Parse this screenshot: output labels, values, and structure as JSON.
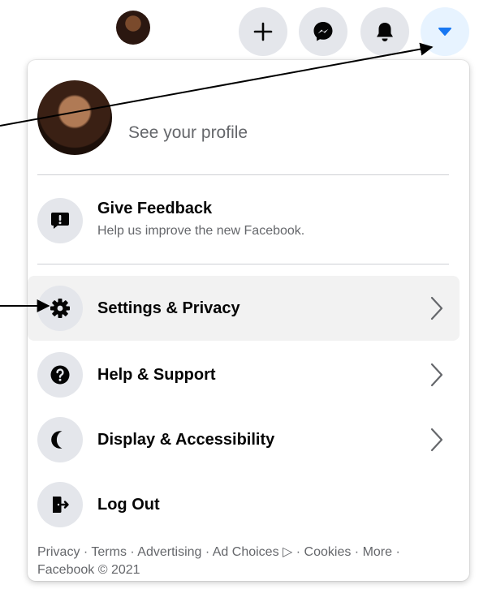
{
  "topbar": {
    "buttons": [
      {
        "icon": "plus-icon"
      },
      {
        "icon": "messenger-icon"
      },
      {
        "icon": "bell-icon"
      },
      {
        "icon": "caret-down-icon"
      }
    ]
  },
  "menu": {
    "profile": {
      "label": "See your profile"
    },
    "feedback": {
      "title": "Give Feedback",
      "subtitle": "Help us improve the new Facebook."
    },
    "items": [
      {
        "label": "Settings & Privacy",
        "icon": "gear-icon",
        "has_submenu": true
      },
      {
        "label": "Help & Support",
        "icon": "question-icon",
        "has_submenu": true
      },
      {
        "label": "Display & Accessibility",
        "icon": "moon-icon",
        "has_submenu": true
      },
      {
        "label": "Log Out",
        "icon": "logout-icon",
        "has_submenu": false
      }
    ],
    "footer": "Privacy · Terms · Advertising · Ad Choices ▷ · Cookies · More · Facebook © 2021"
  },
  "colors": {
    "accent": "#1877f2",
    "icon_bg": "#e4e6eb",
    "secondary_text": "#65676b",
    "hover_bg": "#f2f2f2"
  }
}
